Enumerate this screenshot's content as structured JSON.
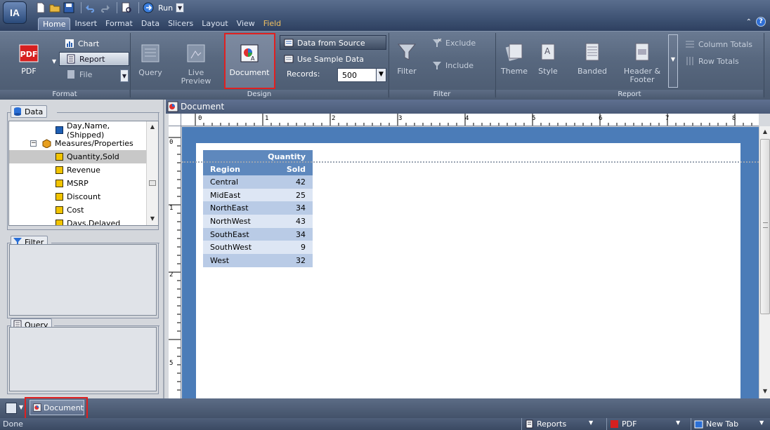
{
  "app": {
    "logo_text": "IA"
  },
  "quick_access": {
    "run_label": "Run"
  },
  "menu_tabs": [
    "Home",
    "Insert",
    "Format",
    "Data",
    "Slicers",
    "Layout",
    "View",
    "Field"
  ],
  "ribbon": {
    "format": {
      "label": "Format",
      "pdf_label": "PDF",
      "pdf_icon_text": "PDF",
      "chart_label": "Chart",
      "report_label": "Report",
      "file_label": "File"
    },
    "design": {
      "label": "Design",
      "query_label": "Query",
      "live_preview_label": "Live\nPreview",
      "live_line1": "Live",
      "live_line2": "Preview",
      "document_label": "Document",
      "data_from_source_label": "Data from Source",
      "use_sample_data_label": "Use Sample Data",
      "records_label": "Records:",
      "records_value": "500"
    },
    "filter": {
      "label": "Filter",
      "filter_label": "Filter",
      "exclude_label": "Exclude",
      "include_label": "Include"
    },
    "report": {
      "label": "Report",
      "theme_label": "Theme",
      "style_label": "Style",
      "banded_label": "Banded",
      "header_line1": "Header &",
      "header_line2": "Footer",
      "column_totals_label": "Column Totals",
      "row_totals_label": "Row Totals"
    }
  },
  "left_panel": {
    "data_title": "Data",
    "tree": [
      {
        "label": "Day,Name,(Shipped)",
        "type": "field-blue"
      },
      {
        "label": "Measures/Properties",
        "type": "folder"
      },
      {
        "label": "Quantity,Sold",
        "type": "field",
        "selected": true
      },
      {
        "label": "Revenue",
        "type": "field"
      },
      {
        "label": "MSRP",
        "type": "field"
      },
      {
        "label": "Discount",
        "type": "field"
      },
      {
        "label": "Cost",
        "type": "field"
      },
      {
        "label": "Days,Delayed",
        "type": "field"
      }
    ],
    "filter_title": "Filter",
    "query_title": "Query"
  },
  "document": {
    "title": "Document",
    "ruler_h": [
      "0",
      "1",
      "2",
      "3",
      "4",
      "5",
      "6",
      "7",
      "8"
    ],
    "ruler_v": [
      "0",
      "1",
      "2",
      "5"
    ],
    "table": {
      "header_top": "Quantity",
      "col1": "Region",
      "col2": "Sold",
      "rows": [
        {
          "region": "Central",
          "sold": "42"
        },
        {
          "region": "MidEast",
          "sold": "25"
        },
        {
          "region": "NorthEast",
          "sold": "34"
        },
        {
          "region": "NorthWest",
          "sold": "43"
        },
        {
          "region": "SouthEast",
          "sold": "34"
        },
        {
          "region": "SouthWest",
          "sold": "9"
        },
        {
          "region": "West",
          "sold": "32"
        }
      ]
    }
  },
  "taskbar": {
    "doc_tab_label": "Document"
  },
  "statusbar": {
    "status_text": "Done",
    "reports_label": "Reports",
    "pdf_label": "PDF",
    "new_tab_label": "New Tab"
  },
  "colors": {
    "highlight": "#e02020",
    "canvas": "#4b7cb8",
    "table_header": "#5e88bd"
  }
}
